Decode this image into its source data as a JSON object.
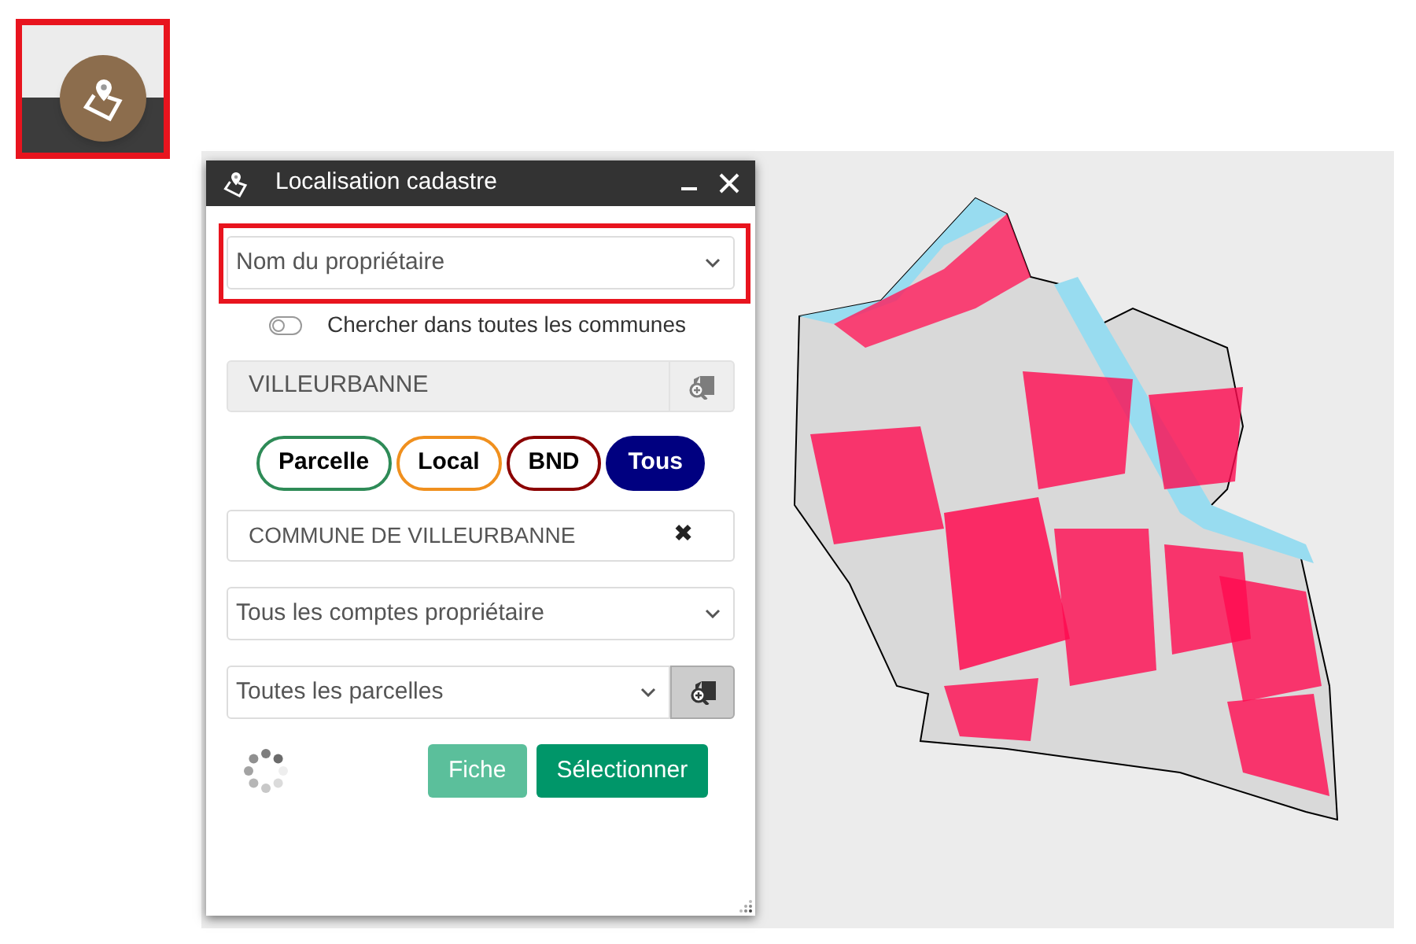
{
  "launcher": {
    "highlighted": true
  },
  "panel": {
    "title": "Localisation cadastre",
    "search_type": {
      "value": "Nom du propriétaire",
      "highlighted": true
    },
    "all_communes_toggle": {
      "label": "Chercher dans toutes les communes",
      "on": false
    },
    "commune": {
      "value": "VILLEURBANNE"
    },
    "filters": [
      {
        "label": "Parcelle",
        "color": "#2e8b57",
        "selected": false
      },
      {
        "label": "Local",
        "color": "#f0901e",
        "selected": false
      },
      {
        "label": "BND",
        "color": "#8b0000",
        "selected": false
      },
      {
        "label": "Tous",
        "color": "#000080",
        "selected": true
      }
    ],
    "owner": {
      "value": "COMMUNE DE VILLEURBANNE",
      "clear": "✖"
    },
    "accounts": {
      "value": "Tous les comptes propriétaire"
    },
    "parcels": {
      "value": "Toutes les parcelles"
    },
    "buttons": [
      {
        "label": "Fiche",
        "disabled": true
      },
      {
        "label": "Sélectionner",
        "disabled": false
      }
    ]
  }
}
